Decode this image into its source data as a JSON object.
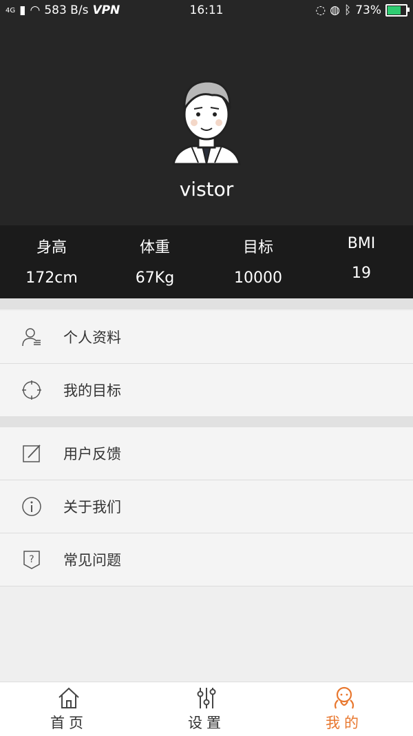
{
  "status_bar": {
    "network": "4G",
    "speed": "583 B/s",
    "vpn": "VPN",
    "time": "16:11",
    "battery": "73%",
    "battery_level": 0.73
  },
  "profile": {
    "username": "vistor"
  },
  "stats": [
    {
      "label": "身高",
      "value": "172cm"
    },
    {
      "label": "体重",
      "value": "67Kg"
    },
    {
      "label": "目标",
      "value": "10000"
    },
    {
      "label": "BMI",
      "value": "19"
    }
  ],
  "menu_group1": [
    {
      "label": "个人资料",
      "icon": "person-icon"
    },
    {
      "label": "我的目标",
      "icon": "target-icon"
    }
  ],
  "menu_group2": [
    {
      "label": "用户反馈",
      "icon": "edit-icon"
    },
    {
      "label": "关于我们",
      "icon": "info-icon"
    },
    {
      "label": "常见问题",
      "icon": "question-icon"
    }
  ],
  "tabs": [
    {
      "label": "首页",
      "icon": "home-icon"
    },
    {
      "label": "设置",
      "icon": "sliders-icon"
    },
    {
      "label": "我的",
      "icon": "user-icon",
      "active": true
    }
  ],
  "colors": {
    "header_bg": "#262626",
    "stats_bg": "#1b1b1b",
    "accent": "#e8772e"
  }
}
